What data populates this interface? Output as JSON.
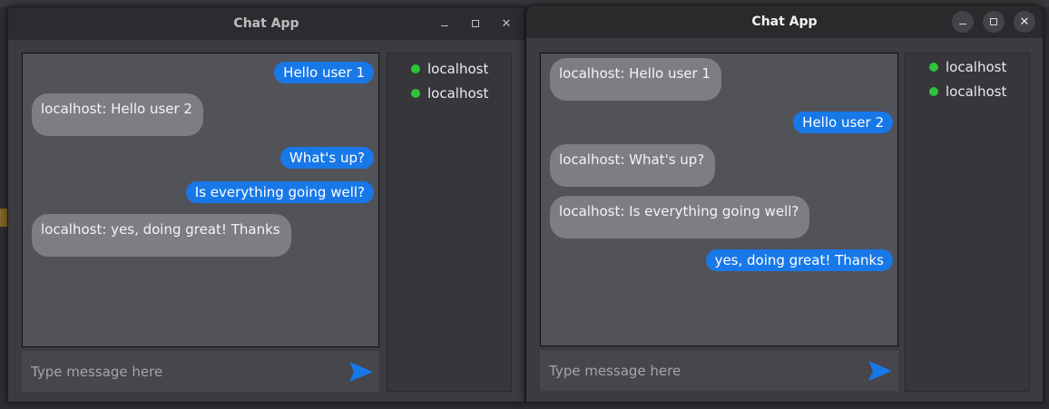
{
  "colors": {
    "accent_blue": "#1878e8",
    "incoming_bubble": "#7e7d84",
    "online_dot": "#2fc23a",
    "chat_bg": "#525259"
  },
  "windows": [
    {
      "title": "Chat App",
      "messages": [
        {
          "direction": "out",
          "text": "Hello user 1"
        },
        {
          "direction": "in",
          "text": "localhost: Hello user 2"
        },
        {
          "direction": "out",
          "text": "What's up?"
        },
        {
          "direction": "out",
          "text": "Is everything going well?"
        },
        {
          "direction": "in",
          "text": "localhost: yes, doing great! Thanks"
        }
      ],
      "users": [
        {
          "name": "localhost",
          "status": "online"
        },
        {
          "name": "localhost",
          "status": "online"
        }
      ],
      "input": {
        "placeholder": "Type message here",
        "value": ""
      },
      "send_icon": "send-arrow-icon"
    },
    {
      "title": "Chat App",
      "messages": [
        {
          "direction": "in",
          "text": "localhost: Hello user 1"
        },
        {
          "direction": "out",
          "text": "Hello user 2"
        },
        {
          "direction": "in",
          "text": "localhost: What's up?"
        },
        {
          "direction": "in",
          "text": "localhost: Is everything going well?"
        },
        {
          "direction": "out",
          "text": "yes, doing great! Thanks"
        }
      ],
      "users": [
        {
          "name": "localhost",
          "status": "online"
        },
        {
          "name": "localhost",
          "status": "online"
        }
      ],
      "input": {
        "placeholder": "Type message here",
        "value": ""
      },
      "send_icon": "send-arrow-icon"
    }
  ]
}
